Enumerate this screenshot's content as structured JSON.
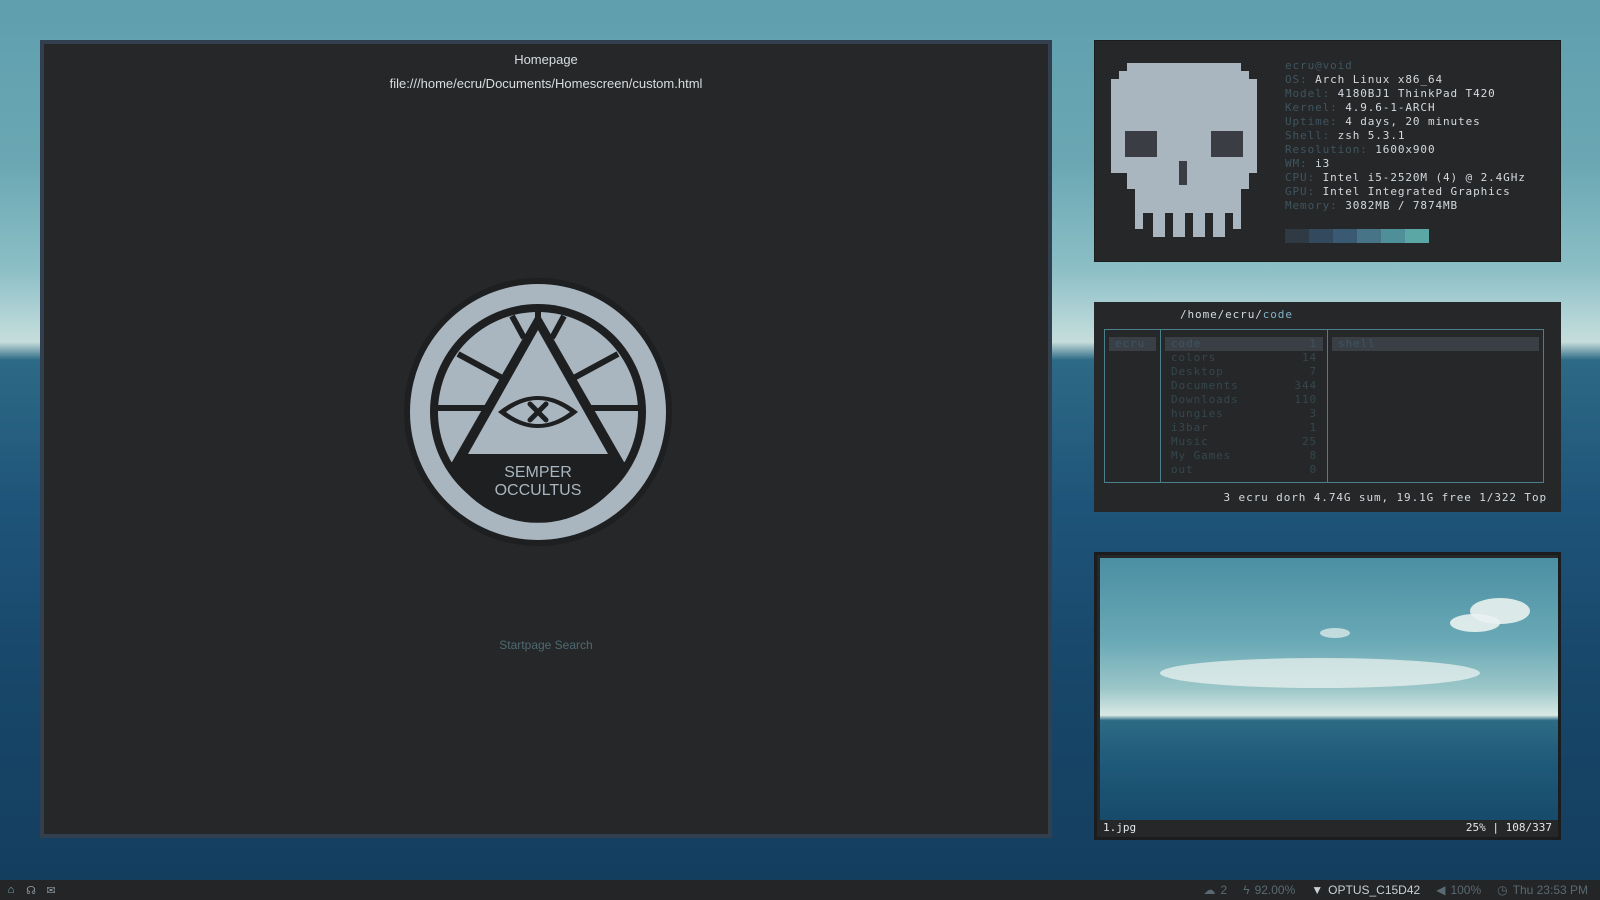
{
  "browser": {
    "title": "Homepage",
    "url": "file:///home/ecru/Documents/Homescreen/custom.html",
    "emblem_text_1": "SEMPER",
    "emblem_text_2": "OCCULTUS",
    "search_placeholder": "Startpage Search"
  },
  "neofetch": {
    "host": "ecru@void",
    "rows": [
      {
        "key": "OS:",
        "value": "Arch Linux x86_64"
      },
      {
        "key": "Model:",
        "value": "4180BJ1 ThinkPad T420"
      },
      {
        "key": "Kernel:",
        "value": "4.9.6-1-ARCH"
      },
      {
        "key": "Uptime:",
        "value": "4 days, 20 minutes"
      },
      {
        "key": "Shell:",
        "value": "zsh 5.3.1"
      },
      {
        "key": "Resolution:",
        "value": "1600x900"
      },
      {
        "key": "WM:",
        "value": "i3"
      },
      {
        "key": "CPU:",
        "value": "Intel i5-2520M (4) @ 2.4GHz"
      },
      {
        "key": "GPU:",
        "value": "Intel Integrated Graphics"
      },
      {
        "key": "Memory:",
        "value": "3082MB / 7874MB"
      }
    ],
    "palette": [
      "#2f3a45",
      "#334a5e",
      "#3a5a73",
      "#477487",
      "#4f8f98",
      "#5aa7a6"
    ]
  },
  "ranger": {
    "path_prefix": "/home/ecru/",
    "path_dir": "code",
    "col1": [
      "ecru"
    ],
    "col2": [
      {
        "name": "code",
        "count": "1"
      },
      {
        "name": "colors",
        "count": "14"
      },
      {
        "name": "Desktop",
        "count": "7"
      },
      {
        "name": "Documents",
        "count": "344"
      },
      {
        "name": "Downloads",
        "count": "110"
      },
      {
        "name": "hungies",
        "count": "3"
      },
      {
        "name": "i3bar",
        "count": "1"
      },
      {
        "name": "Music",
        "count": "25"
      },
      {
        "name": "My Games",
        "count": "8"
      },
      {
        "name": "out",
        "count": "0"
      }
    ],
    "col3": [
      "shell"
    ],
    "status": "3 ecru dorh 4.74G sum, 19.1G free  1/322  Top"
  },
  "viewer": {
    "filename": "1.jpg",
    "position": "25% | 108/337"
  },
  "bar": {
    "left_icons": [
      "home-icon",
      "headphones-icon",
      "mail-icon"
    ],
    "cloud_value": "2",
    "battery": "92.00%",
    "wifi": "OPTUS_C15D42",
    "volume": "100%",
    "clock": "Thu 23:53 PM"
  }
}
